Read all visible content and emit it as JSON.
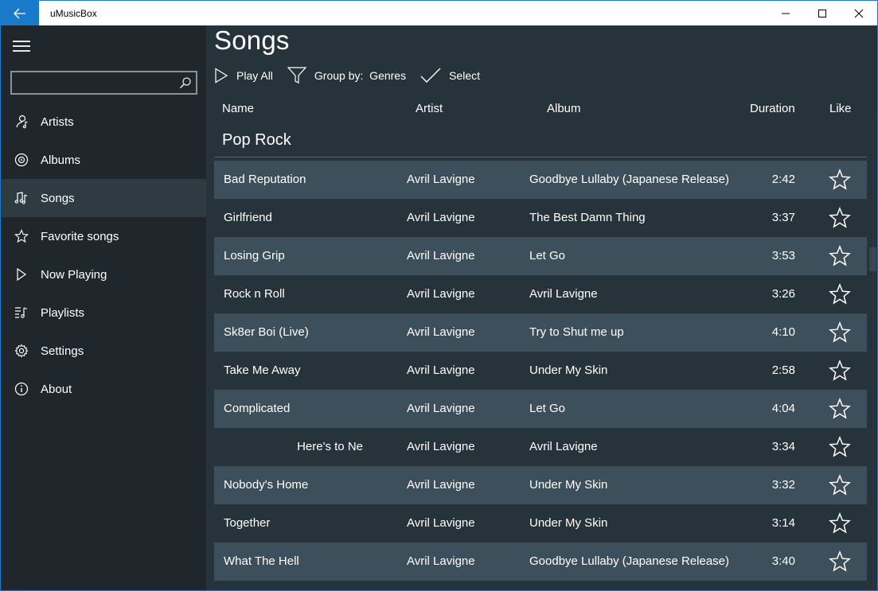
{
  "window": {
    "title": "uMusicBox",
    "accent": "#1979ca"
  },
  "sidebar": {
    "search_placeholder": "",
    "items": [
      {
        "label": "Artists",
        "icon": "artist-icon"
      },
      {
        "label": "Albums",
        "icon": "album-icon"
      },
      {
        "label": "Songs",
        "icon": "music-note-icon",
        "active": true
      },
      {
        "label": "Favorite songs",
        "icon": "star-icon"
      },
      {
        "label": "Now Playing",
        "icon": "play-icon"
      },
      {
        "label": "Playlists",
        "icon": "playlist-icon"
      },
      {
        "label": "Settings",
        "icon": "gear-icon"
      },
      {
        "label": "About",
        "icon": "info-icon"
      }
    ]
  },
  "main": {
    "title": "Songs",
    "toolbar": {
      "play_all": "Play All",
      "group_by": "Group by:  Genres",
      "select": "Select"
    },
    "columns": {
      "name": "Name",
      "artist": "Artist",
      "album": "Album",
      "duration": "Duration",
      "like": "Like"
    },
    "group": "Pop Rock",
    "songs": [
      {
        "name": "Bad Reputation",
        "artist": "Avril Lavigne",
        "album": "Goodbye Lullaby (Japanese Release)",
        "duration": "2:42"
      },
      {
        "name": "Girlfriend",
        "artist": "Avril Lavigne",
        "album": "The Best Damn Thing",
        "duration": "3:37"
      },
      {
        "name": "Losing Grip",
        "artist": "Avril Lavigne",
        "album": "Let Go",
        "duration": "3:53"
      },
      {
        "name": "Rock n Roll",
        "artist": "Avril Lavigne",
        "album": "Avril Lavigne",
        "duration": "3:26"
      },
      {
        "name": "Sk8er Boi (Live)",
        "artist": "Avril Lavigne",
        "album": "Try to Shut me up",
        "duration": "4:10"
      },
      {
        "name": "Take Me Away",
        "artist": "Avril Lavigne",
        "album": "Under My Skin",
        "duration": "2:58"
      },
      {
        "name": "Complicated",
        "artist": "Avril Lavigne",
        "album": "Let Go",
        "duration": "4:04"
      },
      {
        "name": "Here's to Ne",
        "artist": "Avril Lavigne",
        "album": "Avril Lavigne",
        "duration": "3:34"
      },
      {
        "name": "Nobody's Home",
        "artist": "Avril Lavigne",
        "album": "Under My Skin",
        "duration": "3:32"
      },
      {
        "name": "Together",
        "artist": "Avril Lavigne",
        "album": "Under My Skin",
        "duration": "3:14"
      },
      {
        "name": "What The Hell",
        "artist": "Avril Lavigne",
        "album": "Goodbye Lullaby (Japanese Release)",
        "duration": "3:40"
      }
    ]
  },
  "colors": {
    "sidebar_bg": "#1f272c",
    "main_bg": "#27333b",
    "row_alt_bg": "#3d4f5a",
    "active_nav_bg": "#2e3b43"
  }
}
